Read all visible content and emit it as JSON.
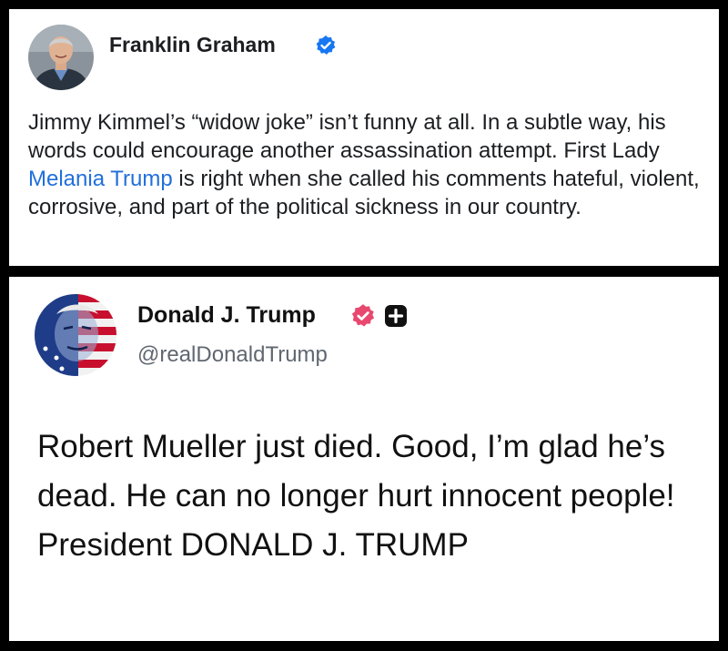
{
  "posts": [
    {
      "author": "Franklin Graham",
      "verified_color": "#1877f2",
      "text_parts": {
        "before": "Jimmy Kimmel’s “widow joke” isn’t funny at all. In a subtle way, his words could encourage another assassination attempt. First Lady ",
        "mention": "Melania Trump",
        "after": " is right when she called his comments hateful, violent, corrosive, and part of the political sickness in our country."
      },
      "mention_color": "#216fdb",
      "icons": {
        "avatar": "profile-photo",
        "verified": "verified-badge-icon"
      }
    },
    {
      "author": "Donald J. Trump",
      "handle": "@realDonaldTrump",
      "verified_color": "#e8486e",
      "text": "Robert Mueller just died. Good, I’m glad he’s dead. He can no longer hurt innocent people! President DONALD J. TRUMP",
      "icons": {
        "avatar": "flag-portrait-avatar",
        "verified": "verified-badge-icon",
        "plus": "plus-badge-icon"
      }
    }
  ]
}
